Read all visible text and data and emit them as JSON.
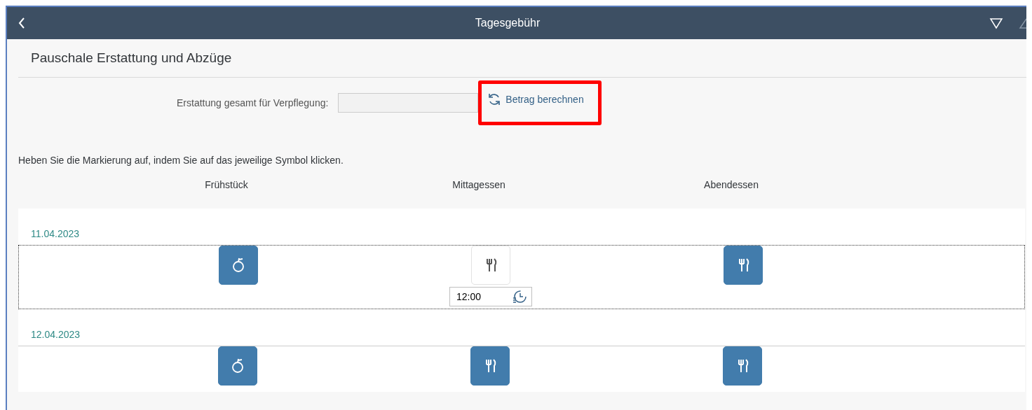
{
  "header": {
    "title": "Tagesgebühr"
  },
  "section": {
    "title": "Pauschale Erstattung und Abzüge"
  },
  "total": {
    "label": "Erstattung gesamt für Verpflegung:",
    "button": {
      "label": "Betrag berechnen",
      "highlighted": true
    }
  },
  "hint": "Heben Sie die Markierung auf, indem Sie auf das jeweilige Symbol klicken.",
  "columns": [
    "Frühstück",
    "Mittagessen",
    "Abendessen"
  ],
  "days": [
    {
      "date": "11.04.2023",
      "selected": true,
      "meals": [
        {
          "kind": "breakfast",
          "marked": true
        },
        {
          "kind": "meal",
          "marked": false,
          "time": "12:00"
        },
        {
          "kind": "meal",
          "marked": true
        }
      ]
    },
    {
      "date": "12.04.2023",
      "selected": false,
      "meals": [
        {
          "kind": "breakfast",
          "marked": true
        },
        {
          "kind": "meal",
          "marked": true
        },
        {
          "kind": "meal",
          "marked": true
        }
      ]
    }
  ]
}
